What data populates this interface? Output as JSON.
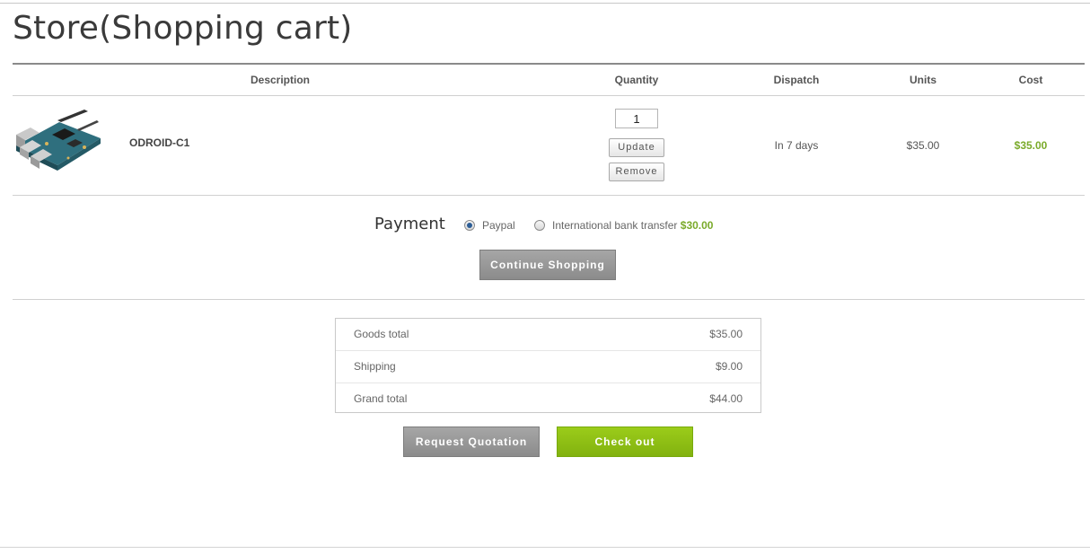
{
  "page": {
    "title": "Store(Shopping cart)"
  },
  "cart_table": {
    "columns": [
      "Description",
      "Quantity",
      "Dispatch",
      "Units",
      "Cost"
    ],
    "items": [
      {
        "name": "ODROID-C1",
        "quantity": "1",
        "update_label": "Update",
        "remove_label": "Remove",
        "dispatch": "In 7 days",
        "units": "$35.00",
        "cost": "$35.00"
      }
    ]
  },
  "payment": {
    "label": "Payment",
    "options": [
      {
        "label": "Paypal",
        "selected": true
      },
      {
        "label": "International bank transfer",
        "price": "$30.00",
        "selected": false
      }
    ]
  },
  "buttons": {
    "continue_shopping": "Continue Shopping",
    "request_quotation": "Request Quotation",
    "check_out": "Check out"
  },
  "totals": [
    {
      "label": "Goods total",
      "value": "$35.00"
    },
    {
      "label": "Shipping",
      "value": "$9.00"
    },
    {
      "label": "Grand total",
      "value": "$44.00"
    }
  ],
  "colors": {
    "accent_green": "#7aaa2a",
    "checkout_green": "#8cbf14",
    "button_gray": "#999999"
  }
}
